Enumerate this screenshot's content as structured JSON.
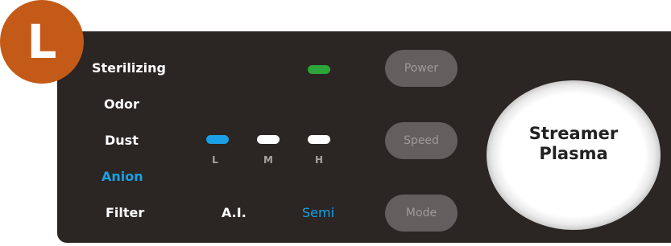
{
  "badge": {
    "letter": "L"
  },
  "indicators": {
    "sterilizing": "Sterilizing",
    "odor": "Odor",
    "dust": "Dust",
    "anion": "Anion",
    "filter": "Filter"
  },
  "fan_speed": {
    "levels": [
      "L",
      "M",
      "H"
    ],
    "active": "L"
  },
  "mode_labels": {
    "ai": "A.I.",
    "semi": "Semi",
    "active": "Semi"
  },
  "buttons": {
    "power": "Power",
    "speed": "Speed",
    "mode": "Mode"
  },
  "plasma": {
    "line1": "Streamer",
    "line2": "Plasma"
  },
  "colors": {
    "panel": "#2b2523",
    "badge": "#c45a17",
    "active_blue": "#1aa0e6",
    "power_led_green": "#2ca63a",
    "button_bg": "#645f5e"
  },
  "icons": {
    "power_led": "green-led-indicator",
    "speed_leds": [
      "blue-led-indicator",
      "white-led-indicator",
      "white-led-indicator"
    ]
  }
}
